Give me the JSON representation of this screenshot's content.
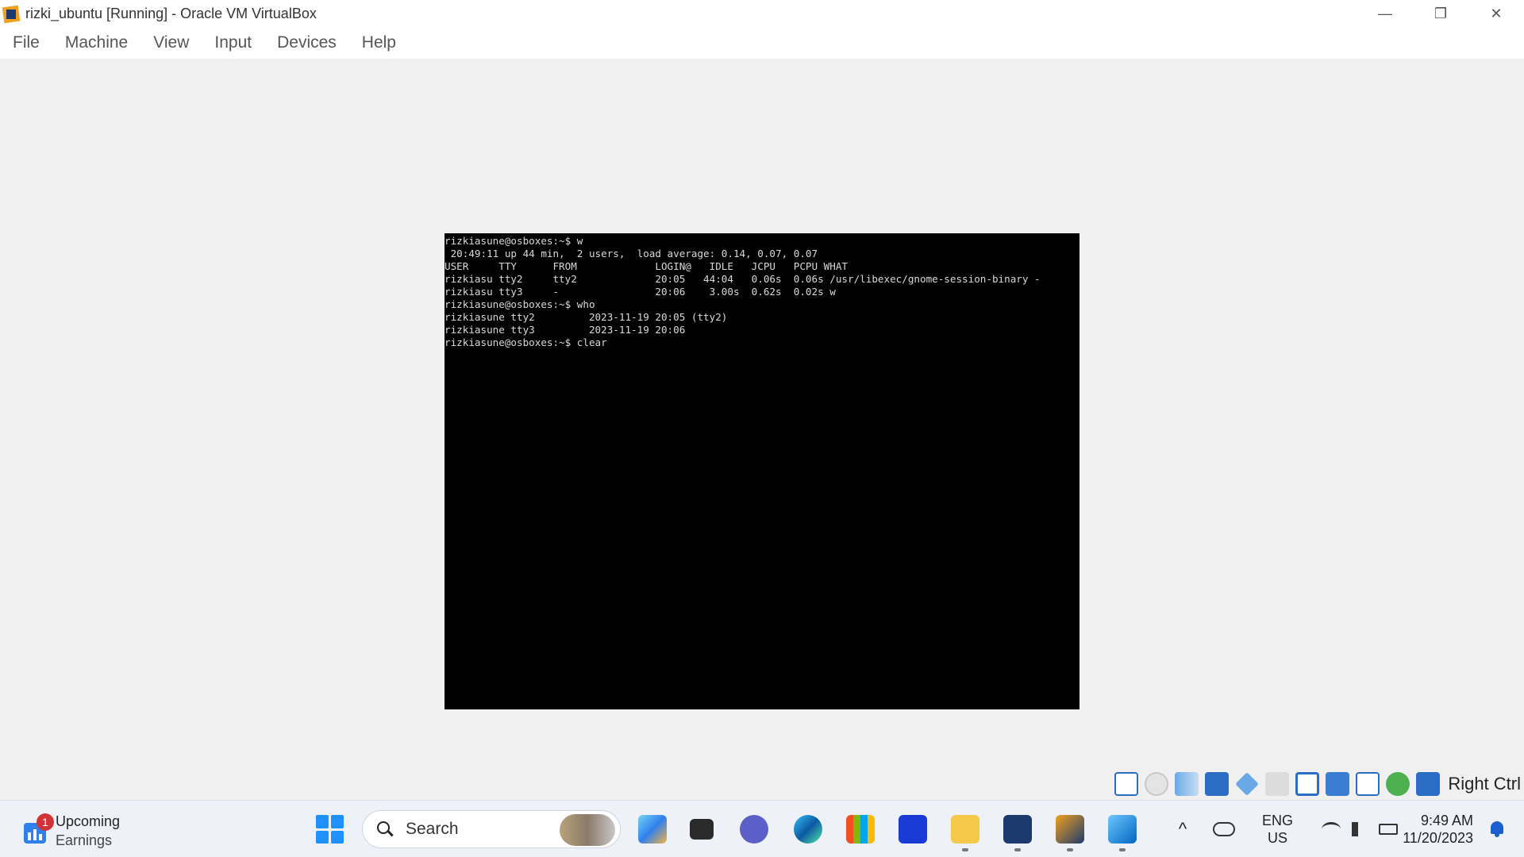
{
  "window": {
    "title": "rizki_ubuntu [Running] - Oracle VM VirtualBox",
    "minimize_glyph": "—",
    "restore_glyph": "❐",
    "close_glyph": "✕"
  },
  "menu": {
    "items": [
      "File",
      "Machine",
      "View",
      "Input",
      "Devices",
      "Help"
    ]
  },
  "terminal": {
    "lines": [
      "rizkiasune@osboxes:~$ w",
      " 20:49:11 up 44 min,  2 users,  load average: 0.14, 0.07, 0.07",
      "USER     TTY      FROM             LOGIN@   IDLE   JCPU   PCPU WHAT",
      "rizkiasu tty2     tty2             20:05   44:04   0.06s  0.06s /usr/libexec/gnome-session-binary -",
      "rizkiasu tty3     -                20:06    3.00s  0.62s  0.02s w",
      "rizkiasune@osboxes:~$ who",
      "rizkiasune tty2         2023-11-19 20:05 (tty2)",
      "rizkiasune tty3         2023-11-19 20:06",
      "rizkiasune@osboxes:~$ clear"
    ]
  },
  "statusbar": {
    "icons": [
      "hard-disk-icon",
      "optical-drive-icon",
      "audio-icon",
      "network-icon",
      "usb-icon",
      "shared-folders-icon",
      "display-icon",
      "recording-icon",
      "vt-x-icon",
      "mouse-integration-icon",
      "guest-additions-icon"
    ],
    "host_key": "Right Ctrl"
  },
  "taskbar": {
    "widget": {
      "badge": "1",
      "line1": "Upcoming",
      "line2": "Earnings"
    },
    "search_placeholder": "Search",
    "apps": [
      "copilot-icon",
      "task-view-icon",
      "teams-chat-icon",
      "edge-icon",
      "store-icon",
      "ai-app-icon",
      "file-explorer-icon",
      "virtualbox-icon",
      "virtualbox-vm-icon",
      "photos-icon"
    ],
    "tray": {
      "chevron": "^",
      "lang_line1": "ENG",
      "lang_line2": "US",
      "time": "9:49 AM",
      "date": "11/20/2023"
    }
  }
}
